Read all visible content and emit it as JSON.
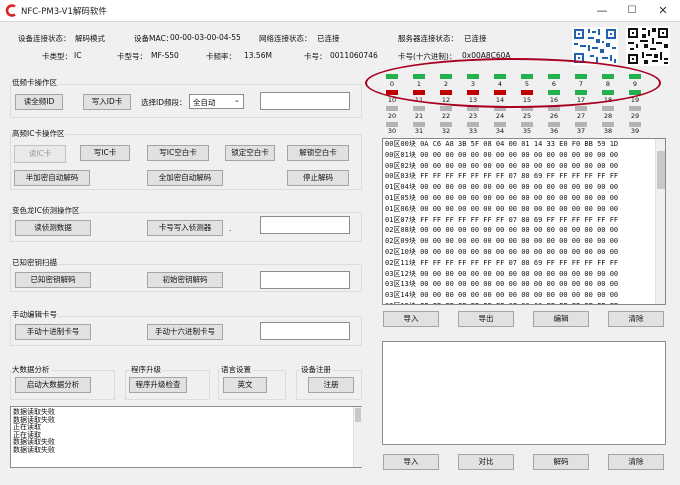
{
  "window": {
    "title": "NFC-PM3-V1解码软件",
    "controls": {
      "minimize": "—",
      "maximize": "☐",
      "close": "✕"
    }
  },
  "status": {
    "device_conn_label": "设备连接状态：",
    "device_conn_value": "解码模式",
    "device_mac_label": "设备MAC：",
    "device_mac_value": "00-00-03-00-04-55",
    "net_conn_label": "网络连接状态：",
    "net_conn_value": "已连接",
    "server_conn_label": "服务器连接状态：",
    "server_conn_value": "已连接",
    "card_type_label": "卡类型：",
    "card_type_value": "IC",
    "card_model_label": "卡型号：",
    "card_model_value": "MF-S50",
    "card_freq_label": "卡频率：",
    "card_freq_value": "13.56M",
    "card_no_label": "卡号：",
    "card_no_value": "0011060746",
    "card_hex_label": "卡号(十六进制)：",
    "card_hex_value": "0x00A8C60A"
  },
  "low_freq": {
    "title": "低频卡操作区",
    "read_id_btn": "读全频ID",
    "write_id_btn": "写入ID卡",
    "select_label": "选择ID频段：",
    "select_value": "全自动",
    "input_value": ""
  },
  "high_freq": {
    "title": "高频IC卡操作区",
    "read_ic_btn": "读IC卡",
    "write_ic_btn": "写IC卡",
    "write_blank_btn": "写IC空白卡",
    "lock_blank_btn": "锁定空白卡",
    "unlock_blank_btn": "解锁空白卡",
    "half_encrypt_btn": "半加密自动解码",
    "full_encrypt_btn": "全加密自动解码",
    "stop_btn": "停止解码"
  },
  "chameleon": {
    "title": "变色龙IC侦测操作区",
    "read_detect_btn": "读侦测数据",
    "write_detect_btn": "卡号写入侦测器",
    "dot": ".",
    "input_value": ""
  },
  "known_key": {
    "title": "已知密钥扫描",
    "decode_btn": "已知密钥解码",
    "init_btn": "初始密钥解码",
    "input_value": ""
  },
  "manual": {
    "title": "手动编辑卡号",
    "decimal_btn": "手动十进制卡号",
    "hex_btn": "手动十六进制卡号",
    "input_value": ""
  },
  "bigdata": {
    "title": "大数据分析",
    "btn": "启动大数据分析"
  },
  "upgrade": {
    "title": "程序升级",
    "btn": "程序升级检查"
  },
  "language": {
    "title": "语言设置",
    "btn": "英文"
  },
  "register": {
    "title": "设备注册",
    "btn": "注册"
  },
  "log": {
    "lines": [
      "数据读取失败",
      "数据读取失败",
      "正在读取",
      "正在读取",
      "数据读取失败",
      "数据读取失败"
    ]
  },
  "sectors": {
    "row1": [
      "0",
      "1",
      "2",
      "3",
      "4",
      "5",
      "6",
      "7",
      "8",
      "9"
    ],
    "row2": [
      "10",
      "11",
      "12",
      "13",
      "14",
      "15",
      "16",
      "17",
      "18",
      "19"
    ],
    "row3": [
      "20",
      "21",
      "22",
      "23",
      "24",
      "25",
      "26",
      "27",
      "28",
      "29"
    ],
    "row4": [
      "30",
      "31",
      "32",
      "33",
      "34",
      "35",
      "36",
      "37",
      "38",
      "39"
    ],
    "colors": {
      "top_leds": "#22b14c",
      "red_leds": "#c00000",
      "green_leds_row2": "#22b14c",
      "grey_leds": "#b4b4b4"
    },
    "row2_states": [
      "red",
      "red",
      "red",
      "red",
      "red",
      "red",
      "green",
      "green",
      "green",
      "green"
    ]
  },
  "hex_grid": {
    "rows": [
      "00区00块 0A C6 A8 3B 5F 08 04 00 01 14 33 E0 F0 BB 59 1D",
      "00区01块 00 00 00 00 00 00 00 00 00 00 00 00 00 00 00 00",
      "00区02块 00 00 00 00 00 00 00 00 00 00 00 00 00 00 00 00",
      "00区03块 FF FF FF FF FF FF FF 07 80 69 FF FF FF FF FF FF",
      "01区04块 00 00 00 00 00 00 00 00 00 00 00 00 00 00 00 00",
      "01区05块 00 00 00 00 00 00 00 00 00 00 00 00 00 00 00 00",
      "01区06块 00 00 00 00 00 00 00 00 00 00 00 00 00 00 00 00",
      "01区07块 FF FF FF FF FF FF FF 07 80 69 FF FF FF FF FF FF",
      "02区08块 00 00 00 00 00 00 00 00 00 00 00 00 00 00 00 00",
      "02区09块 00 00 00 00 00 00 00 00 00 00 00 00 00 00 00 00",
      "02区10块 00 00 00 00 00 00 00 00 00 00 00 00 00 00 00 00",
      "02区11块 FF FF FF FF FF FF FF 07 80 69 FF FF FF FF FF FF",
      "03区12块 00 00 00 00 00 00 00 00 00 00 00 00 00 00 00 00",
      "03区13块 00 00 00 00 00 00 00 00 00 00 00 00 00 00 00 00",
      "03区14块 00 00 00 00 00 00 00 00 00 00 00 00 00 00 00 00",
      "03区15块 FF FF FF FF FF FF FF 07 80 69 FF FF FF FF FF FF",
      "04区16块 00 00 00 00 00 00 00 00 00 00 00 00 00 00 00 00",
      "04区17块 FF FF FF FF FF FF FF 07 80 69 FF FF FF FF FF FF"
    ]
  },
  "hex_buttons": {
    "import": "导入",
    "export": "导出",
    "edit": "编辑",
    "clear": "清除"
  },
  "bottom_buttons": {
    "import": "导入",
    "compare": "对比",
    "decode": "解码",
    "clear": "清除"
  },
  "colors": {
    "accent": "#3c7fc8",
    "titlebar_logo": "#e02020",
    "mark_circle": "#a80020"
  }
}
